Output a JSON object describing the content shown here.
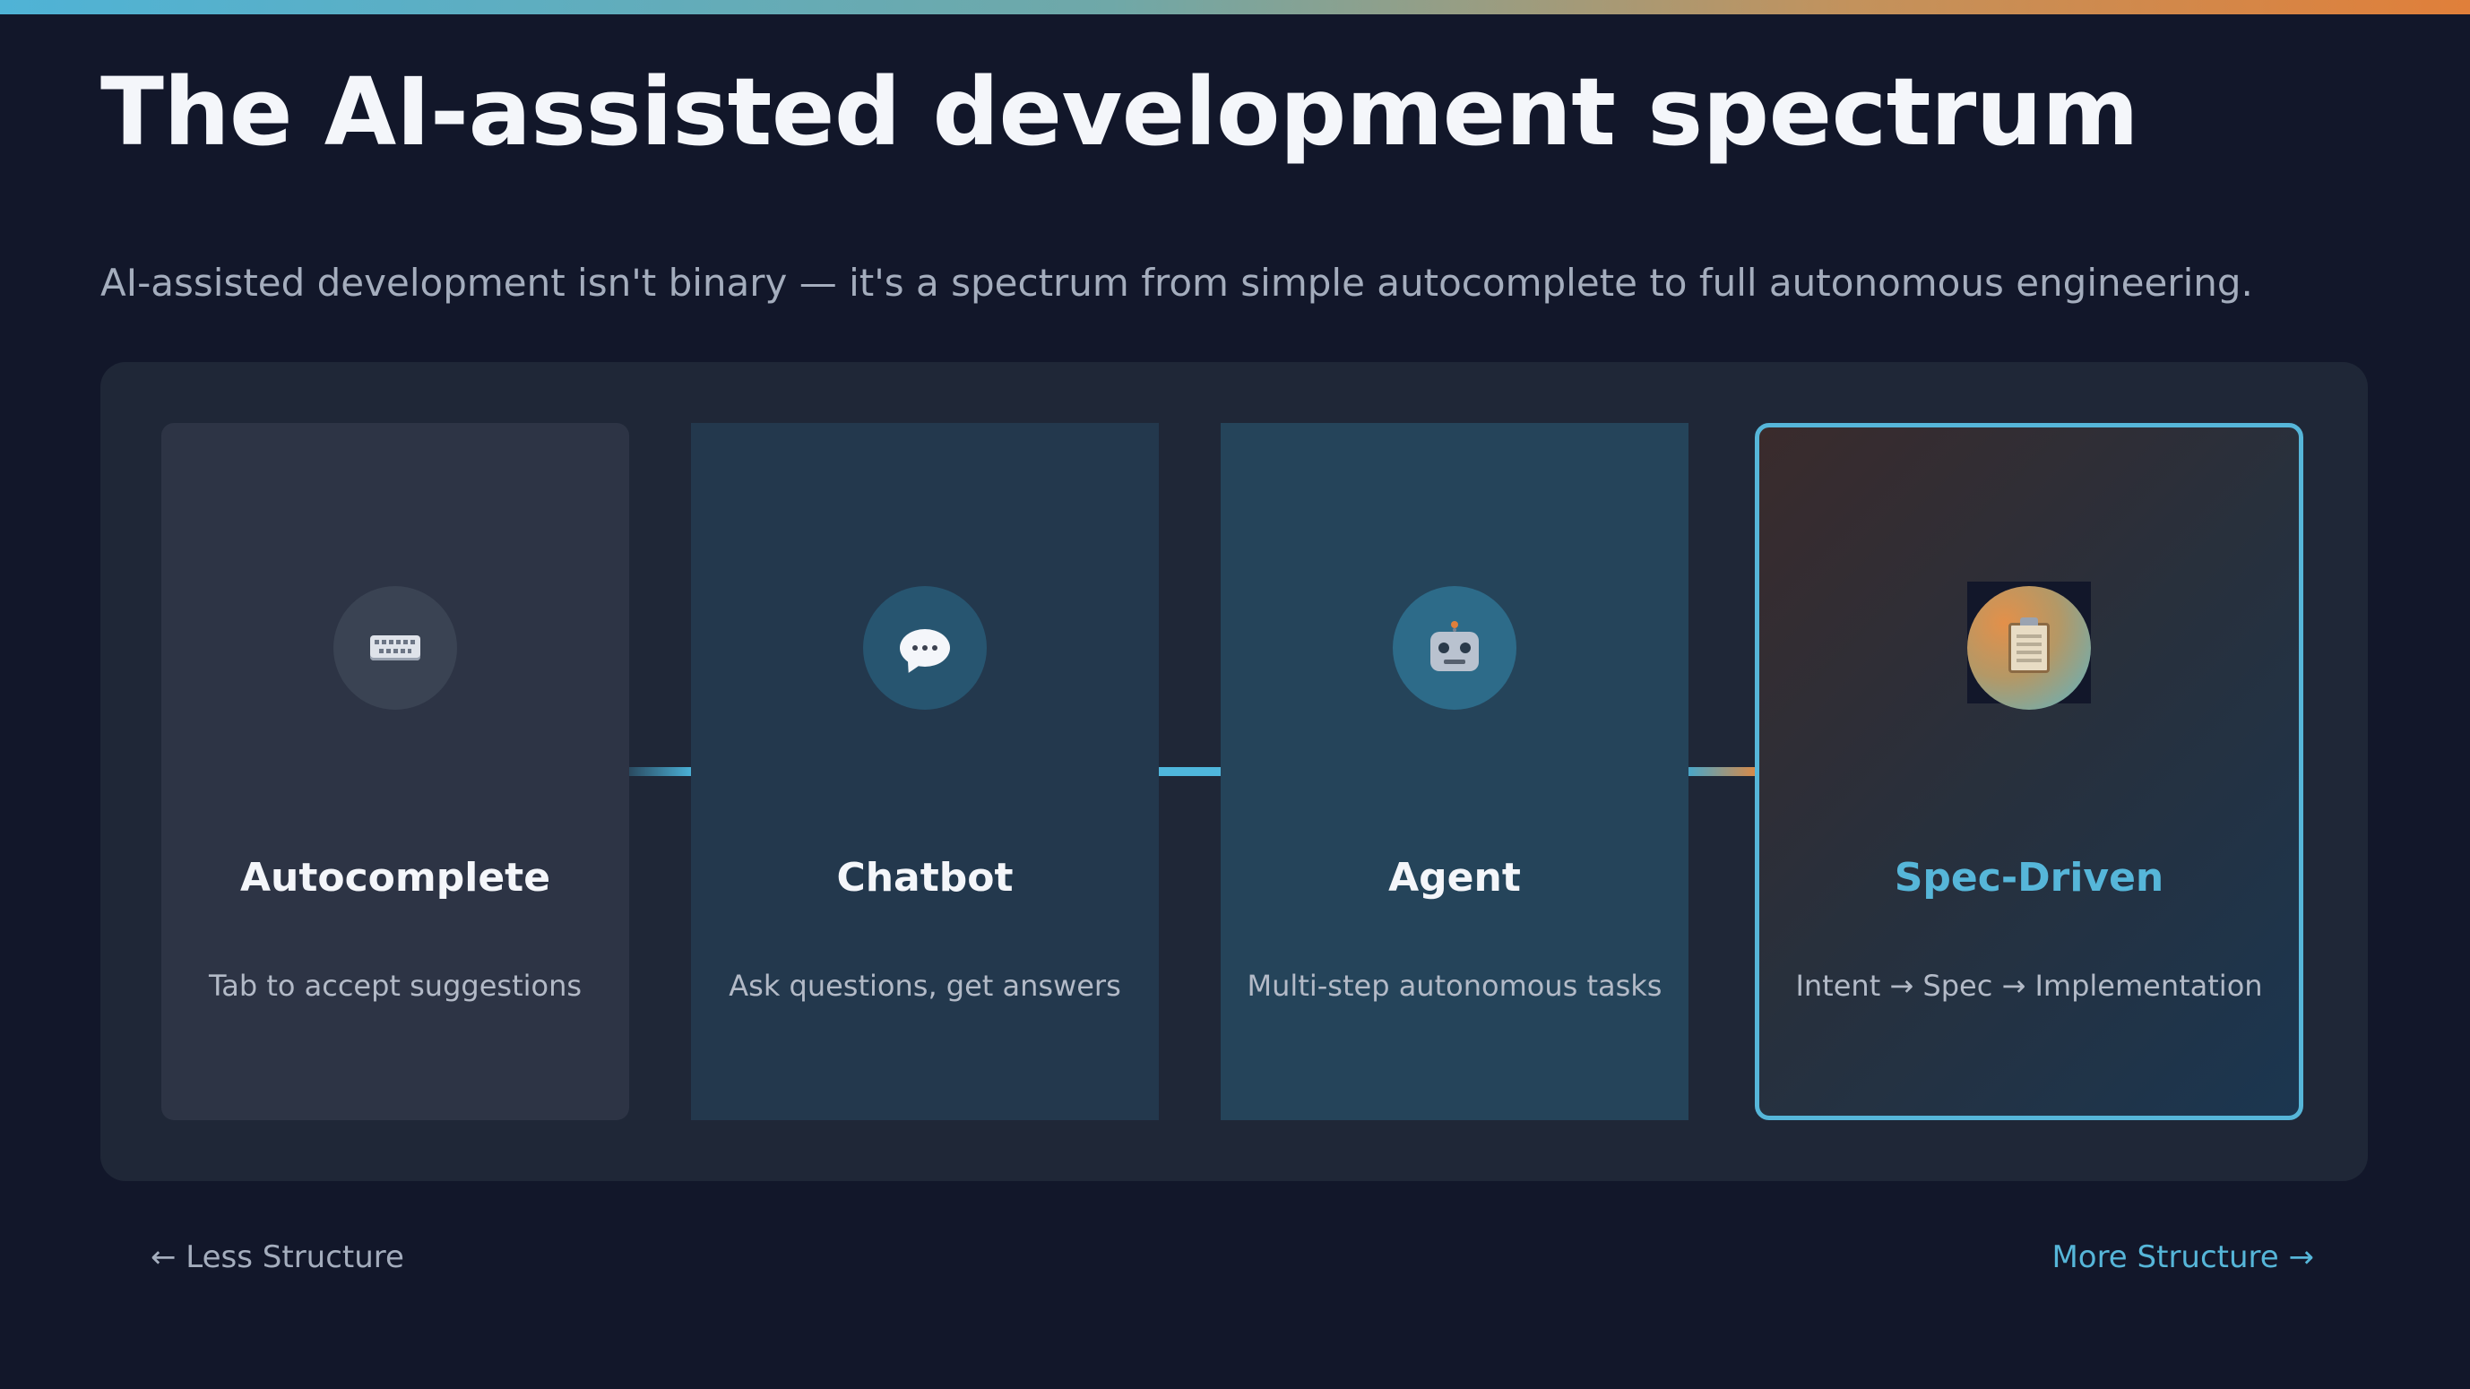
{
  "header": {
    "title": "The AI-assisted development spectrum",
    "subtitle": "AI-assisted development isn't binary — it's a spectrum from simple autocomplete to full autonomous engineering."
  },
  "spectrum": {
    "stages": [
      {
        "name": "Autocomplete",
        "description": "Tab to accept suggestions",
        "icon": "keyboard-icon"
      },
      {
        "name": "Chatbot",
        "description": "Ask questions, get answers",
        "icon": "speech-bubble-icon"
      },
      {
        "name": "Agent",
        "description": "Multi-step autonomous tasks",
        "icon": "robot-icon"
      },
      {
        "name": "Spec-Driven",
        "description": "Intent → Spec → Implementation",
        "icon": "clipboard-icon",
        "highlighted": true
      }
    ],
    "axis": {
      "left_label": "← Less Structure",
      "right_label": "More Structure →"
    }
  },
  "colors": {
    "background": "#12172a",
    "panel": "#1f2737",
    "accent_blue": "#56b6d9",
    "accent_orange": "#e07f3a",
    "title_text": "#f4f6fa",
    "muted_text": "#a4adbd"
  }
}
